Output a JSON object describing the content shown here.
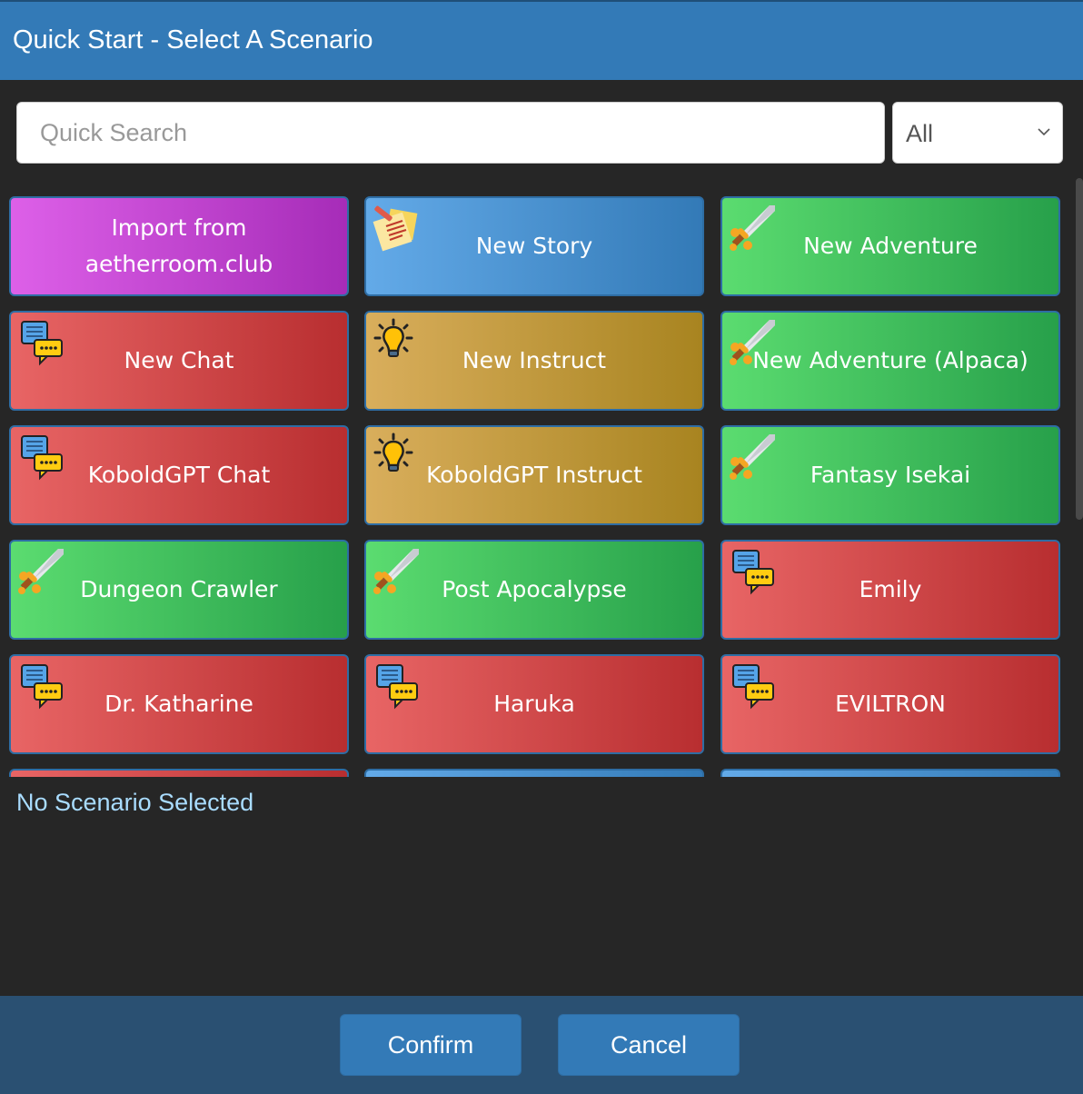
{
  "header": {
    "title": "Quick Start - Select A Scenario"
  },
  "search": {
    "placeholder": "Quick Search",
    "value": ""
  },
  "filter": {
    "selected": "All"
  },
  "scenarios": [
    {
      "label": "Import from aetherroom.club",
      "color": "purple",
      "icon": "none"
    },
    {
      "label": "New Story",
      "color": "blue",
      "icon": "story-note-icon"
    },
    {
      "label": "New Adventure",
      "color": "green",
      "icon": "sword-icon"
    },
    {
      "label": "New Chat",
      "color": "red",
      "icon": "chat-bubbles-icon"
    },
    {
      "label": "New Instruct",
      "color": "gold",
      "icon": "lightbulb-icon"
    },
    {
      "label": "New Adventure (Alpaca)",
      "color": "green",
      "icon": "sword-icon"
    },
    {
      "label": "KoboldGPT Chat",
      "color": "red",
      "icon": "chat-bubbles-icon"
    },
    {
      "label": "KoboldGPT Instruct",
      "color": "gold",
      "icon": "lightbulb-icon"
    },
    {
      "label": "Fantasy Isekai",
      "color": "green",
      "icon": "sword-icon"
    },
    {
      "label": "Dungeon Crawler",
      "color": "green",
      "icon": "sword-icon"
    },
    {
      "label": "Post Apocalypse",
      "color": "green",
      "icon": "sword-icon"
    },
    {
      "label": "Emily",
      "color": "red",
      "icon": "chat-bubbles-icon"
    },
    {
      "label": "Dr. Katharine",
      "color": "red",
      "icon": "chat-bubbles-icon"
    },
    {
      "label": "Haruka",
      "color": "red",
      "icon": "chat-bubbles-icon"
    },
    {
      "label": "EVILTRON",
      "color": "red",
      "icon": "chat-bubbles-icon"
    },
    {
      "label": "",
      "color": "red",
      "icon": "none"
    },
    {
      "label": "",
      "color": "blue",
      "icon": "none"
    },
    {
      "label": "",
      "color": "blue",
      "icon": "none"
    }
  ],
  "status": {
    "text": "No Scenario Selected"
  },
  "footer": {
    "confirm_label": "Confirm",
    "cancel_label": "Cancel"
  },
  "colors": {
    "header": "#337ab7",
    "background": "#262626",
    "footer": "#2a5072",
    "status_text": "#a9dcff"
  }
}
